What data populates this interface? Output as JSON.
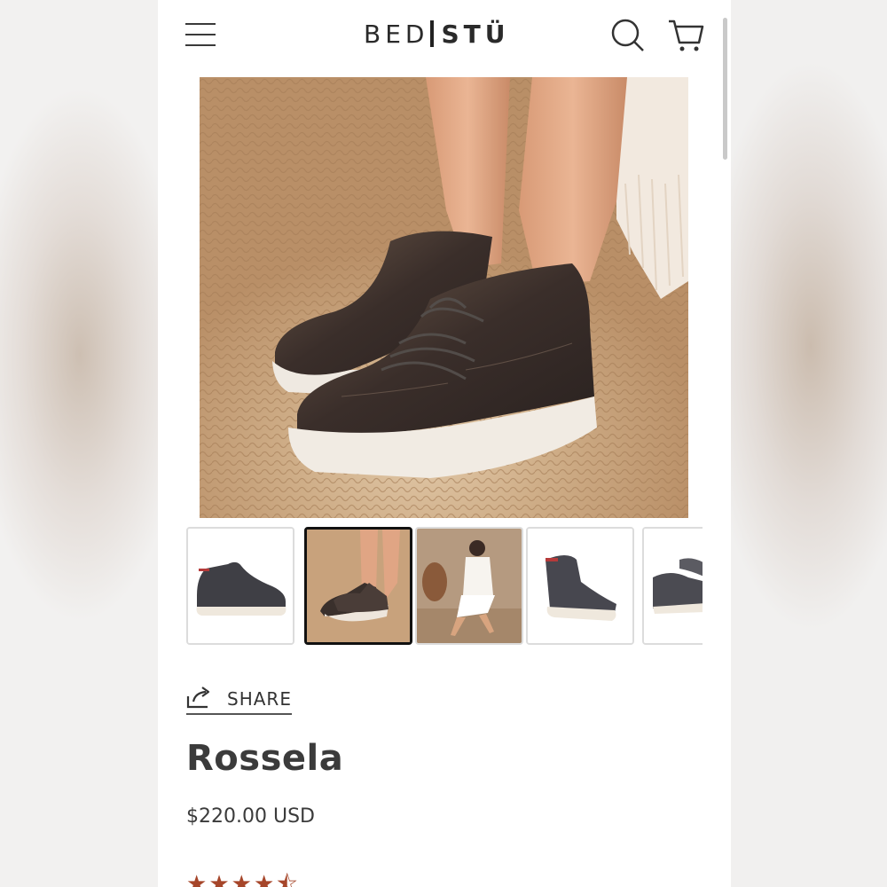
{
  "header": {
    "logo_left": "BED",
    "logo_right": "STÜ",
    "icons": [
      "menu-icon",
      "search-icon",
      "cart-icon"
    ]
  },
  "gallery": {
    "thumbnail_count_visible": 5,
    "selected_index": 1
  },
  "share": {
    "label": "SHARE"
  },
  "product": {
    "name": "Rossela",
    "price": "$220.00 USD",
    "rating": 4.5
  },
  "colors": {
    "text": "#3b3b3b",
    "star": "#a6462a",
    "selected_border": "#111111"
  }
}
